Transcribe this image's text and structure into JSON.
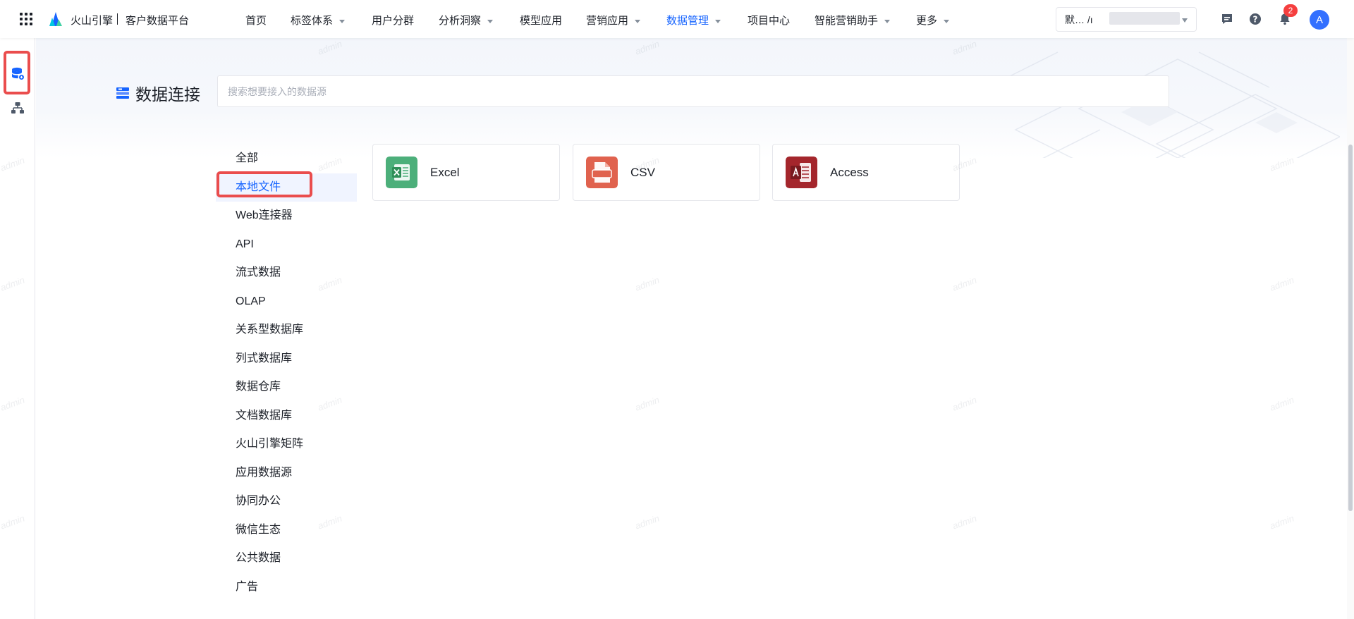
{
  "topbar": {
    "brand": "火山引擎",
    "product": "客户数据平台",
    "nav": [
      {
        "label": "首页"
      },
      {
        "label": "标签体系"
      },
      {
        "label": "用户分群"
      },
      {
        "label": "分析洞察"
      },
      {
        "label": "模型应用"
      },
      {
        "label": "营销应用"
      },
      {
        "label": "数据管理"
      },
      {
        "label": "项目中心"
      },
      {
        "label": "智能营销助手"
      },
      {
        "label": "更多"
      }
    ],
    "workspace_text": "默…  /ı",
    "notification_count": "2",
    "avatar_letter": "A"
  },
  "page": {
    "title": "数据连接",
    "search_placeholder": "搜索想要接入的数据源"
  },
  "categories": [
    "全部",
    "本地文件",
    "Web连接器",
    "API",
    "流式数据",
    "OLAP",
    "关系型数据库",
    "列式数据库",
    "数据仓库",
    "文档数据库",
    "火山引擎矩阵",
    "应用数据源",
    "协同办公",
    "微信生态",
    "公共数据",
    "广告"
  ],
  "active_category": "本地文件",
  "connectors": [
    {
      "label": "Excel",
      "icon": "excel-icon",
      "color": "#4caf7a"
    },
    {
      "label": "CSV",
      "icon": "csv-icon",
      "color": "#e0624e"
    },
    {
      "label": "Access",
      "icon": "access-icon",
      "color": "#a4262c"
    }
  ],
  "watermark": "admin",
  "colors": {
    "accent": "#1664ff",
    "highlight": "#ea4d4d"
  }
}
